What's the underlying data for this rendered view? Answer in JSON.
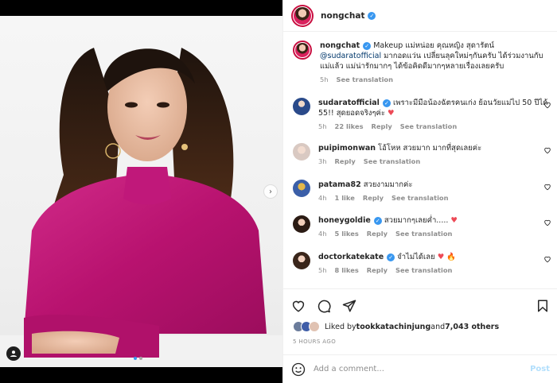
{
  "post": {
    "username": "nongchat",
    "caption": {
      "username": "nongchat",
      "before_mention": " Makeup แม่หน่อย คุณหญิง สุดารัตน์ ",
      "mention": "@sudaratofficial",
      "after_mention": " มากอดแว่น เปลี่ยนลุคใหม่ๆกันครับ ได้ร่วมงานกับแม่แล้ว แม่น่ารักมากๆ ได้ข้อคิดดีมากๆหลายเรื่องเลยครับ",
      "time": "5h",
      "see_translation": "See translation"
    },
    "comments": [
      {
        "username": "sudaratofficial",
        "verified": true,
        "text": "เพราะมีมือน้องฉัตรคนเก่ง ย้อนวัยแม่ไป 50 ปีได้ 55!! สุดยอดจริงๆค่ะ",
        "emoji": "♥",
        "time": "5h",
        "likes": "22 likes",
        "reply": "Reply",
        "see_translation": "See translation"
      },
      {
        "username": "puipimonwan",
        "verified": false,
        "text": "โอ้โหห สวยมาก มากที่สุดเลยค่ะ",
        "emoji": "",
        "time": "3h",
        "likes": "",
        "reply": "Reply",
        "see_translation": "See translation"
      },
      {
        "username": "patama82",
        "verified": false,
        "text": "สวยงามมากค่ะ",
        "emoji": "",
        "time": "4h",
        "likes": "1 like",
        "reply": "Reply",
        "see_translation": "See translation"
      },
      {
        "username": "honeygoldie",
        "verified": true,
        "text": "สวยมากๆเลยค่ำ.....",
        "emoji": "♥",
        "time": "4h",
        "likes": "5 likes",
        "reply": "Reply",
        "see_translation": "See translation"
      },
      {
        "username": "doctorkatekate",
        "verified": true,
        "text": "จำไม่ได้เลย",
        "emoji": "♥ 🔥",
        "time": "5h",
        "likes": "8 likes",
        "reply": "Reply",
        "see_translation": "See translation"
      }
    ],
    "liked_by": {
      "prefix": "Liked by ",
      "user": "tookkatachinjung",
      "middle": " and ",
      "count": "7,043 others"
    },
    "timestamp": "5 HOURS AGO",
    "add_comment": {
      "placeholder": "Add a comment...",
      "post_label": "Post"
    }
  },
  "colors": {
    "accent": "#3897f0",
    "heart": "#ed4956",
    "post_disabled": "#b2dffc",
    "shirt": "#c2187a"
  },
  "icons": [
    "heart-icon",
    "comment-icon",
    "share-icon",
    "bookmark-icon",
    "emoji-icon",
    "verified-icon",
    "chevron-right-icon",
    "user-tag-icon"
  ]
}
